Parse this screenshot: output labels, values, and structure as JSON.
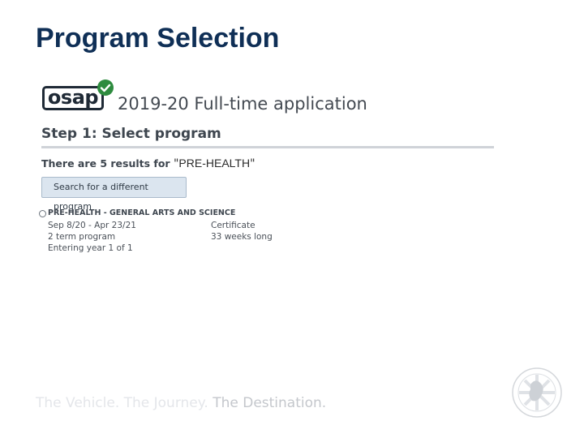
{
  "slide": {
    "title": "Program Selection"
  },
  "app": {
    "logo_text": "osap",
    "title": "2019-20 Full-time application",
    "step_heading": "Step 1: Select program",
    "results_prefix": "There are 5 results for",
    "open_quote": "\"",
    "search_term": "PRE-HEALTH",
    "close_quote": "\"",
    "search_button_label": "Search for a different program",
    "program": {
      "name": "PRE-HEALTH - GENERAL ARTS AND SCIENCE",
      "dates": "Sep 8/20 - Apr 23/21",
      "credential": "Certificate",
      "terms": "2 term program",
      "duration": "33 weeks long",
      "entry": "Entering year 1 of 1"
    }
  },
  "footer": {
    "tagline_part1": "The Vehicle. The Journey.",
    "tagline_part2": "The Destination."
  },
  "icons": {
    "logo_check": "check-circle-icon",
    "crest": "crest-icon"
  },
  "colors": {
    "title": "#0f2f56",
    "check_badge": "#2e8b3f",
    "button_bg": "#dbe5ef",
    "divider": "#cfd3d8"
  }
}
